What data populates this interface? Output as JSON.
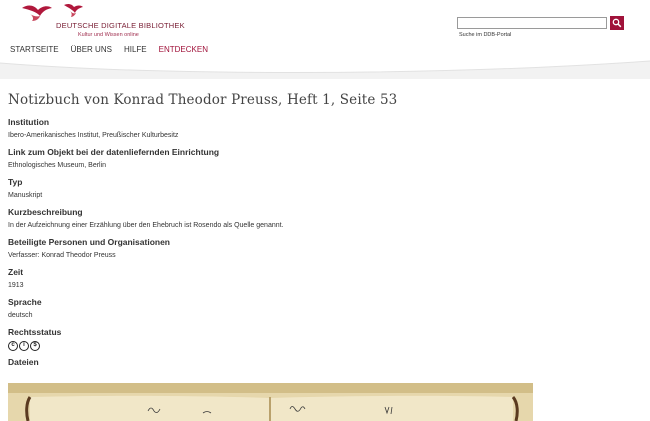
{
  "logo": {
    "title": "DEUTSCHE DIGITALE BIBLIOTHEK",
    "subtitle": "Kultur und Wissen online"
  },
  "nav": {
    "items": [
      {
        "label": "STARTSEITE"
      },
      {
        "label": "ÜBER UNS"
      },
      {
        "label": "HILFE"
      },
      {
        "label": "ENTDECKEN"
      }
    ]
  },
  "search": {
    "caption": "Suche im DDB-Portal",
    "value": ""
  },
  "colors": {
    "accent": "#a0123a",
    "text": "#333333"
  },
  "page": {
    "title": "Notizbuch von Konrad Theodor Preuss, Heft 1, Seite 53"
  },
  "fields": {
    "institution": {
      "label": "Institution",
      "value": "Ibero-Amerikanisches Institut, Preußischer Kulturbesitz"
    },
    "link": {
      "label": "Link zum Objekt bei der datenliefernden Einrichtung",
      "value": "Ethnologisches Museum, Berlin"
    },
    "typ": {
      "label": "Typ",
      "value": "Manuskript"
    },
    "kurz": {
      "label": "Kurzbeschreibung",
      "value": "In der Aufzeichnung einer Erzählung über den Ehebruch ist Rosendo als Quelle genannt."
    },
    "personen": {
      "label": "Beteiligte Personen und Organisationen",
      "value": "Verfasser: Konrad Theodor Preuss"
    },
    "zeit": {
      "label": "Zeit",
      "value": "1913"
    },
    "sprache": {
      "label": "Sprache",
      "value": "deutsch"
    },
    "recht": {
      "label": "Rechtsstatus"
    },
    "dateien": {
      "label": "Dateien"
    }
  },
  "icons": {
    "license": [
      "cc-icon",
      "by-icon",
      "nc-icon"
    ]
  }
}
